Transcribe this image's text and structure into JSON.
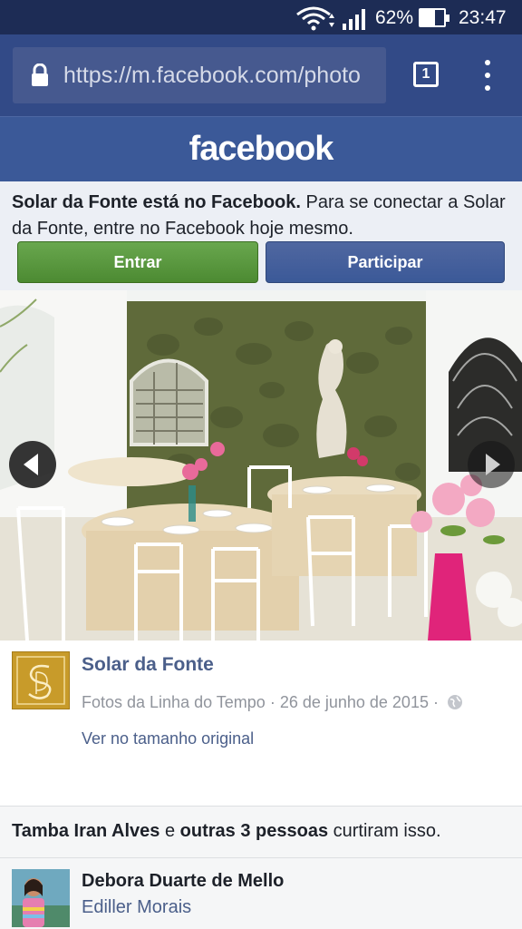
{
  "status_bar": {
    "battery_percent": "62%",
    "battery_level": 0.62,
    "time": "23:47"
  },
  "browser": {
    "url": "https://m.facebook.com/photo",
    "tab_count": "1"
  },
  "header": {
    "logo": "facebook",
    "color": "#3b5998"
  },
  "connect": {
    "bold": "Solar da Fonte está no Facebook.",
    "rest": " Para se conectar a Solar da Fonte, entre no Facebook hoje mesmo.",
    "login_label": "Entrar",
    "signup_label": "Participar"
  },
  "post": {
    "page_name": "Solar da Fonte",
    "album": "Fotos da Linha do Tempo",
    "sep1": " · ",
    "date": "26 de junho de 2015",
    "sep2": " · ",
    "view_original": "Ver no tamanho original"
  },
  "likes": {
    "first_name": "Tamba Iran Alves",
    "connector": " e ",
    "others": "outras 3 pessoas",
    "suffix": " curtiram isso."
  },
  "comment": {
    "author": "Debora Duarte de Mello",
    "text": "Ediller Morais"
  },
  "icons": {
    "wifi": "wifi-icon",
    "signal": "signal-icon",
    "battery": "battery-icon",
    "lock": "lock-icon",
    "tabs": "tabs-icon",
    "menu": "overflow-menu-icon",
    "prev": "chevron-left-icon",
    "next": "chevron-right-icon",
    "globe": "globe-icon"
  }
}
